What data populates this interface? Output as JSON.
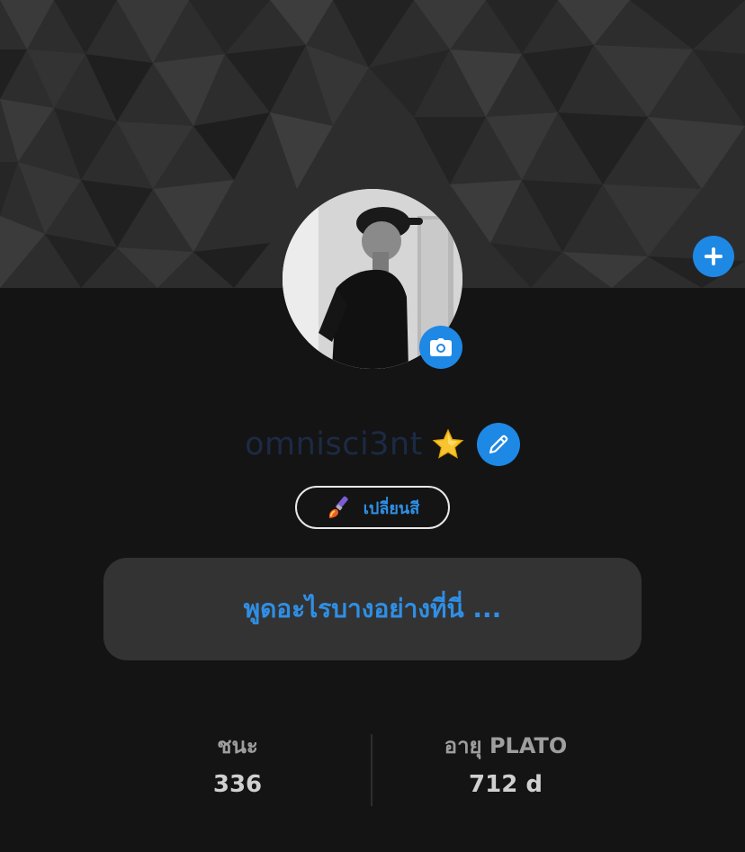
{
  "profile": {
    "username": "omnisci3nt",
    "badge_icon": "star-icon",
    "avatar_alt": "profile photo"
  },
  "actions": {
    "add_icon": "plus-icon",
    "camera_icon": "camera-icon",
    "edit_icon": "pencil-icon",
    "change_color_label": "เปลี่ยนสี",
    "change_color_icon": "paintbrush-icon"
  },
  "status": {
    "placeholder": "พูดอะไรบางอย่างที่นี่ ..."
  },
  "stats": {
    "wins_label": "ชนะ",
    "wins_value": "336",
    "age_label": "อายุ PLATO",
    "age_value": "712 d"
  },
  "colors": {
    "accent": "#1e88e5",
    "background": "#141414",
    "status_box": "#333333",
    "username": "#1c2a44"
  }
}
